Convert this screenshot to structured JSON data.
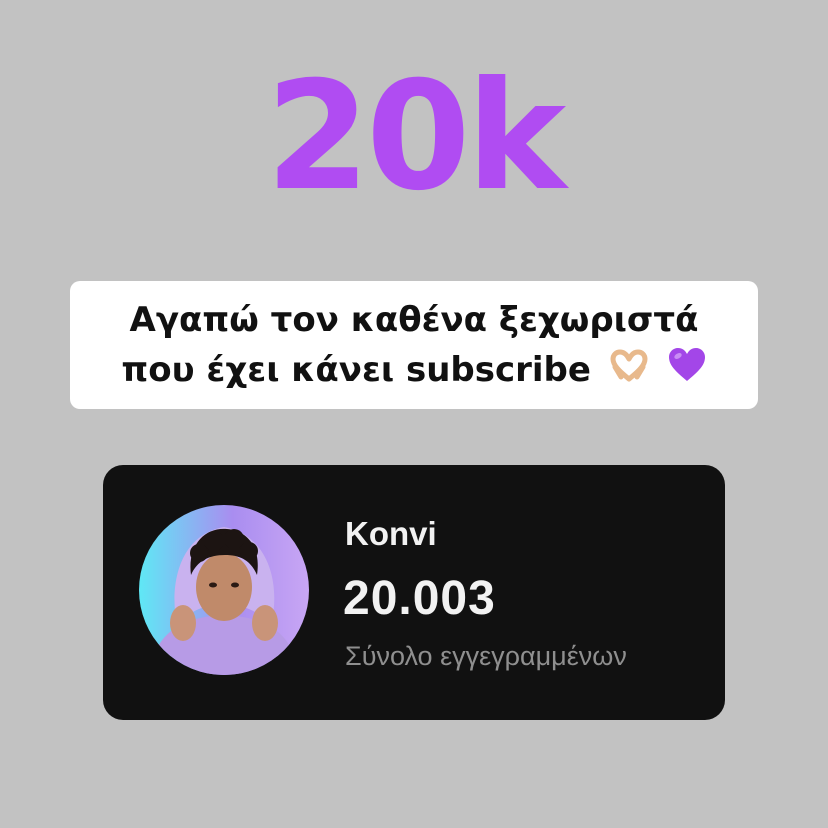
{
  "headline": {
    "text": "20k",
    "color": "#b04cf2"
  },
  "caption": {
    "line1": "Αγαπώ τον καθένα ξεχωριστά",
    "line2": "που έχει κάνει subscribe",
    "emojis": [
      "heart-hands-emoji",
      "purple-heart-emoji"
    ]
  },
  "stats_card": {
    "channel_name": "Konvi",
    "subscriber_count": "20.003",
    "subscriber_label": "Σύνολο εγγεγραμμένων"
  },
  "colors": {
    "background": "#c2c2c2",
    "accent": "#b04cf2",
    "card": "#111111"
  }
}
